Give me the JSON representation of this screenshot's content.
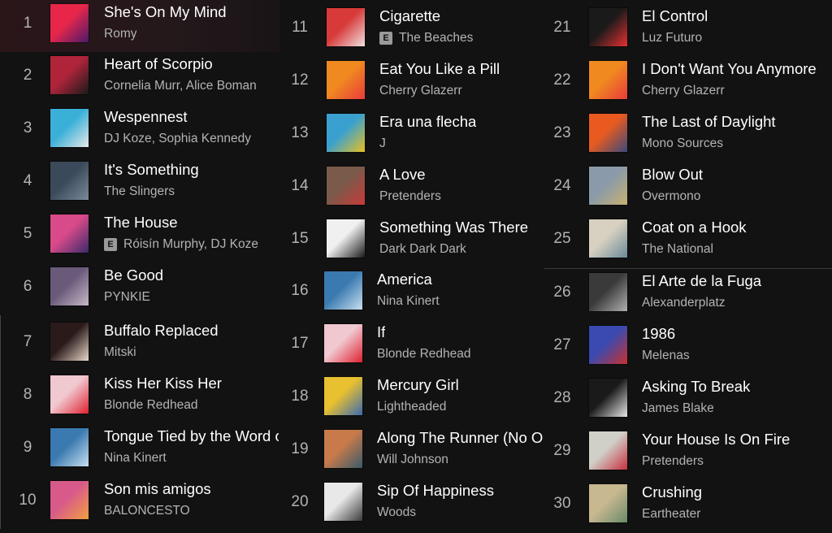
{
  "explicit_label": "E",
  "tracks": [
    {
      "num": "1",
      "title": "She's On My Mind",
      "artist": "Romy",
      "explicit": false
    },
    {
      "num": "2",
      "title": "Heart of Scorpio",
      "artist": "Cornelia Murr, Alice Boman",
      "explicit": false
    },
    {
      "num": "3",
      "title": "Wespennest",
      "artist": "DJ Koze, Sophia Kennedy",
      "explicit": false
    },
    {
      "num": "4",
      "title": "It's Something",
      "artist": "The Slingers",
      "explicit": false
    },
    {
      "num": "5",
      "title": "The House",
      "artist": "Róisín Murphy, DJ Koze",
      "explicit": true
    },
    {
      "num": "6",
      "title": "Be Good",
      "artist": "PYNKIE",
      "explicit": false
    },
    {
      "num": "7",
      "title": "Buffalo Replaced",
      "artist": "Mitski",
      "explicit": false
    },
    {
      "num": "8",
      "title": "Kiss Her Kiss Her",
      "artist": "Blonde Redhead",
      "explicit": false
    },
    {
      "num": "9",
      "title": "Tongue Tied by the Word of",
      "artist": "Nina Kinert",
      "explicit": false
    },
    {
      "num": "10",
      "title": "Son mis amigos",
      "artist": "BALONCESTO",
      "explicit": false
    },
    {
      "num": "11",
      "title": "Cigarette",
      "artist": "The Beaches",
      "explicit": true
    },
    {
      "num": "12",
      "title": "Eat You Like a Pill",
      "artist": "Cherry Glazerr",
      "explicit": false
    },
    {
      "num": "13",
      "title": "Era una flecha",
      "artist": "J",
      "explicit": false
    },
    {
      "num": "14",
      "title": "A Love",
      "artist": "Pretenders",
      "explicit": false
    },
    {
      "num": "15",
      "title": "Something Was There",
      "artist": "Dark Dark Dark",
      "explicit": false
    },
    {
      "num": "16",
      "title": "America",
      "artist": "Nina Kinert",
      "explicit": false
    },
    {
      "num": "17",
      "title": "If",
      "artist": "Blonde Redhead",
      "explicit": false
    },
    {
      "num": "18",
      "title": "Mercury Girl",
      "artist": "Lightheaded",
      "explicit": false
    },
    {
      "num": "19",
      "title": "Along The Runner (No O",
      "artist": "Will Johnson",
      "explicit": false
    },
    {
      "num": "20",
      "title": "Sip Of Happiness",
      "artist": "Woods",
      "explicit": false
    },
    {
      "num": "21",
      "title": "El Control",
      "artist": "Luz Futuro",
      "explicit": false
    },
    {
      "num": "22",
      "title": "I Don't Want You Anymore",
      "artist": "Cherry Glazerr",
      "explicit": false
    },
    {
      "num": "23",
      "title": "The Last of Daylight",
      "artist": "Mono Sources",
      "explicit": false
    },
    {
      "num": "24",
      "title": "Blow Out",
      "artist": "Overmono",
      "explicit": false
    },
    {
      "num": "25",
      "title": "Coat on a Hook",
      "artist": "The National",
      "explicit": false
    },
    {
      "num": "26",
      "title": "El Arte de la Fuga",
      "artist": "Alexanderplatz",
      "explicit": false
    },
    {
      "num": "27",
      "title": "1986",
      "artist": "Melenas",
      "explicit": false
    },
    {
      "num": "28",
      "title": "Asking To Break",
      "artist": "James Blake",
      "explicit": false
    },
    {
      "num": "29",
      "title": "Your House Is On Fire",
      "artist": "Pretenders",
      "explicit": false
    },
    {
      "num": "30",
      "title": "Crushing",
      "artist": "Eartheater",
      "explicit": false
    }
  ],
  "art_colors": [
    [
      "#e8264a",
      "#4a1a6a"
    ],
    [
      "#b0243a",
      "#1a1a1a"
    ],
    [
      "#3ab0d8",
      "#e8e8e8"
    ],
    [
      "#3a4a5a",
      "#7a8a9a"
    ],
    [
      "#d84a8a",
      "#3a2a6a"
    ],
    [
      "#6a5a7a",
      "#c8b8c8"
    ],
    [
      "#2a1a1a",
      "#e8d8c8"
    ],
    [
      "#f0c8d0",
      "#e02030"
    ],
    [
      "#3a7ab0",
      "#c8e0f0"
    ],
    [
      "#d85a8a",
      "#f0a040"
    ],
    [
      "#d83a3a",
      "#f0e0e0"
    ],
    [
      "#f08a20",
      "#e83a3a"
    ],
    [
      "#3aa0d0",
      "#e8c020"
    ],
    [
      "#7a5a4a",
      "#c83a3a"
    ],
    [
      "#f0f0f0",
      "#1a1a1a"
    ],
    [
      "#3a7ab0",
      "#c8e0f0"
    ],
    [
      "#f0c8d0",
      "#e02030"
    ],
    [
      "#e8c030",
      "#3a6ab0"
    ],
    [
      "#c87a4a",
      "#3a5a6a"
    ],
    [
      "#e8e8e8",
      "#3a3a3a"
    ],
    [
      "#1a1a1a",
      "#e83030"
    ],
    [
      "#f08a20",
      "#e83a3a"
    ],
    [
      "#e85a20",
      "#3a4a7a"
    ],
    [
      "#8a9aaa",
      "#c8b070"
    ],
    [
      "#d8d0c0",
      "#6a8a9a"
    ],
    [
      "#3a3a3a",
      "#b0b0b0"
    ],
    [
      "#3a4ab0",
      "#c83030"
    ],
    [
      "#1a1a1a",
      "#e8e8e8"
    ],
    [
      "#d0d0c8",
      "#c83040"
    ],
    [
      "#c8b890",
      "#6a8a6a"
    ]
  ]
}
